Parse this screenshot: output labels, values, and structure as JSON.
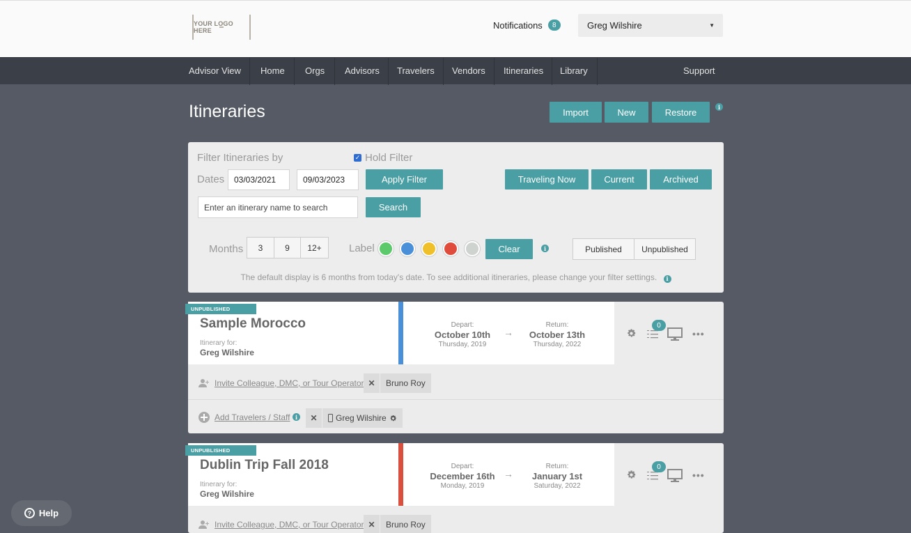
{
  "header": {
    "logo_text": "YOUR LOGO HERE",
    "notifications_label": "Notifications",
    "notifications_count": "8",
    "user_name": "Greg Wilshire",
    "caret": "▼"
  },
  "nav": {
    "items": [
      "Advisor View",
      "Home",
      "Orgs",
      "Advisors",
      "Travelers",
      "Vendors",
      "Itineraries",
      "Library"
    ],
    "support": "Support"
  },
  "page": {
    "title": "Itineraries",
    "buttons": {
      "import": "Import",
      "new": "New",
      "restore": "Restore"
    },
    "info_glyph": "i"
  },
  "filter": {
    "heading": "Filter Itineraries by",
    "hold_filter_label": "Hold Filter",
    "hold_filter_checked": true,
    "dates_label": "Dates",
    "date_from": "03/03/2021",
    "date_to": "09/03/2023",
    "apply_label": "Apply Filter",
    "quick_buttons": {
      "traveling_now": "Traveling Now",
      "current": "Current",
      "archived": "Archived"
    },
    "search_placeholder": "Enter an itinerary name to search",
    "search_button": "Search",
    "months_label": "Months",
    "months_options": [
      "3",
      "9",
      "12+"
    ],
    "label_label": "Label",
    "label_colors": [
      "#5cc96b",
      "#4a90d9",
      "#f0c02a",
      "#e04c3c",
      "#cfd3d0"
    ],
    "clear_label": "Clear",
    "publish_options": [
      "Published",
      "Unpublished"
    ],
    "note": "The default display is 6 months from today's date. To see additional itineraries, please change your filter settings."
  },
  "itineraries": [
    {
      "status": "UNPUBLISHED",
      "name": "Sample Morocco",
      "for_label": "Itinerary for:",
      "for_name": "Greg Wilshire",
      "stripe_color": "#4a90d9",
      "depart_label": "Depart:",
      "depart_date": "October 10th",
      "depart_day": "Thursday, 2019",
      "return_label": "Return:",
      "return_date": "October 13th",
      "return_day": "Thursday, 2022",
      "checklist_count": "0",
      "invite_link": "Invite Colleague, DMC, or Tour Operator",
      "collaborator": "Bruno Roy",
      "add_travelers_link": "Add Travelers / Staff",
      "traveler": "Greg Wilshire"
    },
    {
      "status": "UNPUBLISHED",
      "name": "Dublin Trip Fall 2018",
      "for_label": "Itinerary for:",
      "for_name": "Greg Wilshire",
      "stripe_color": "#d9503f",
      "depart_label": "Depart:",
      "depart_date": "December 16th",
      "depart_day": "Monday, 2019",
      "return_label": "Return:",
      "return_date": "January 1st",
      "return_day": "Saturday, 2022",
      "checklist_count": "0",
      "invite_link": "Invite Colleague, DMC, or Tour Operator",
      "collaborator": "Bruno Roy"
    }
  ],
  "help": {
    "label": "Help",
    "glyph": "?"
  },
  "glyphs": {
    "arrow": "→",
    "close": "✕",
    "check": "✓"
  }
}
